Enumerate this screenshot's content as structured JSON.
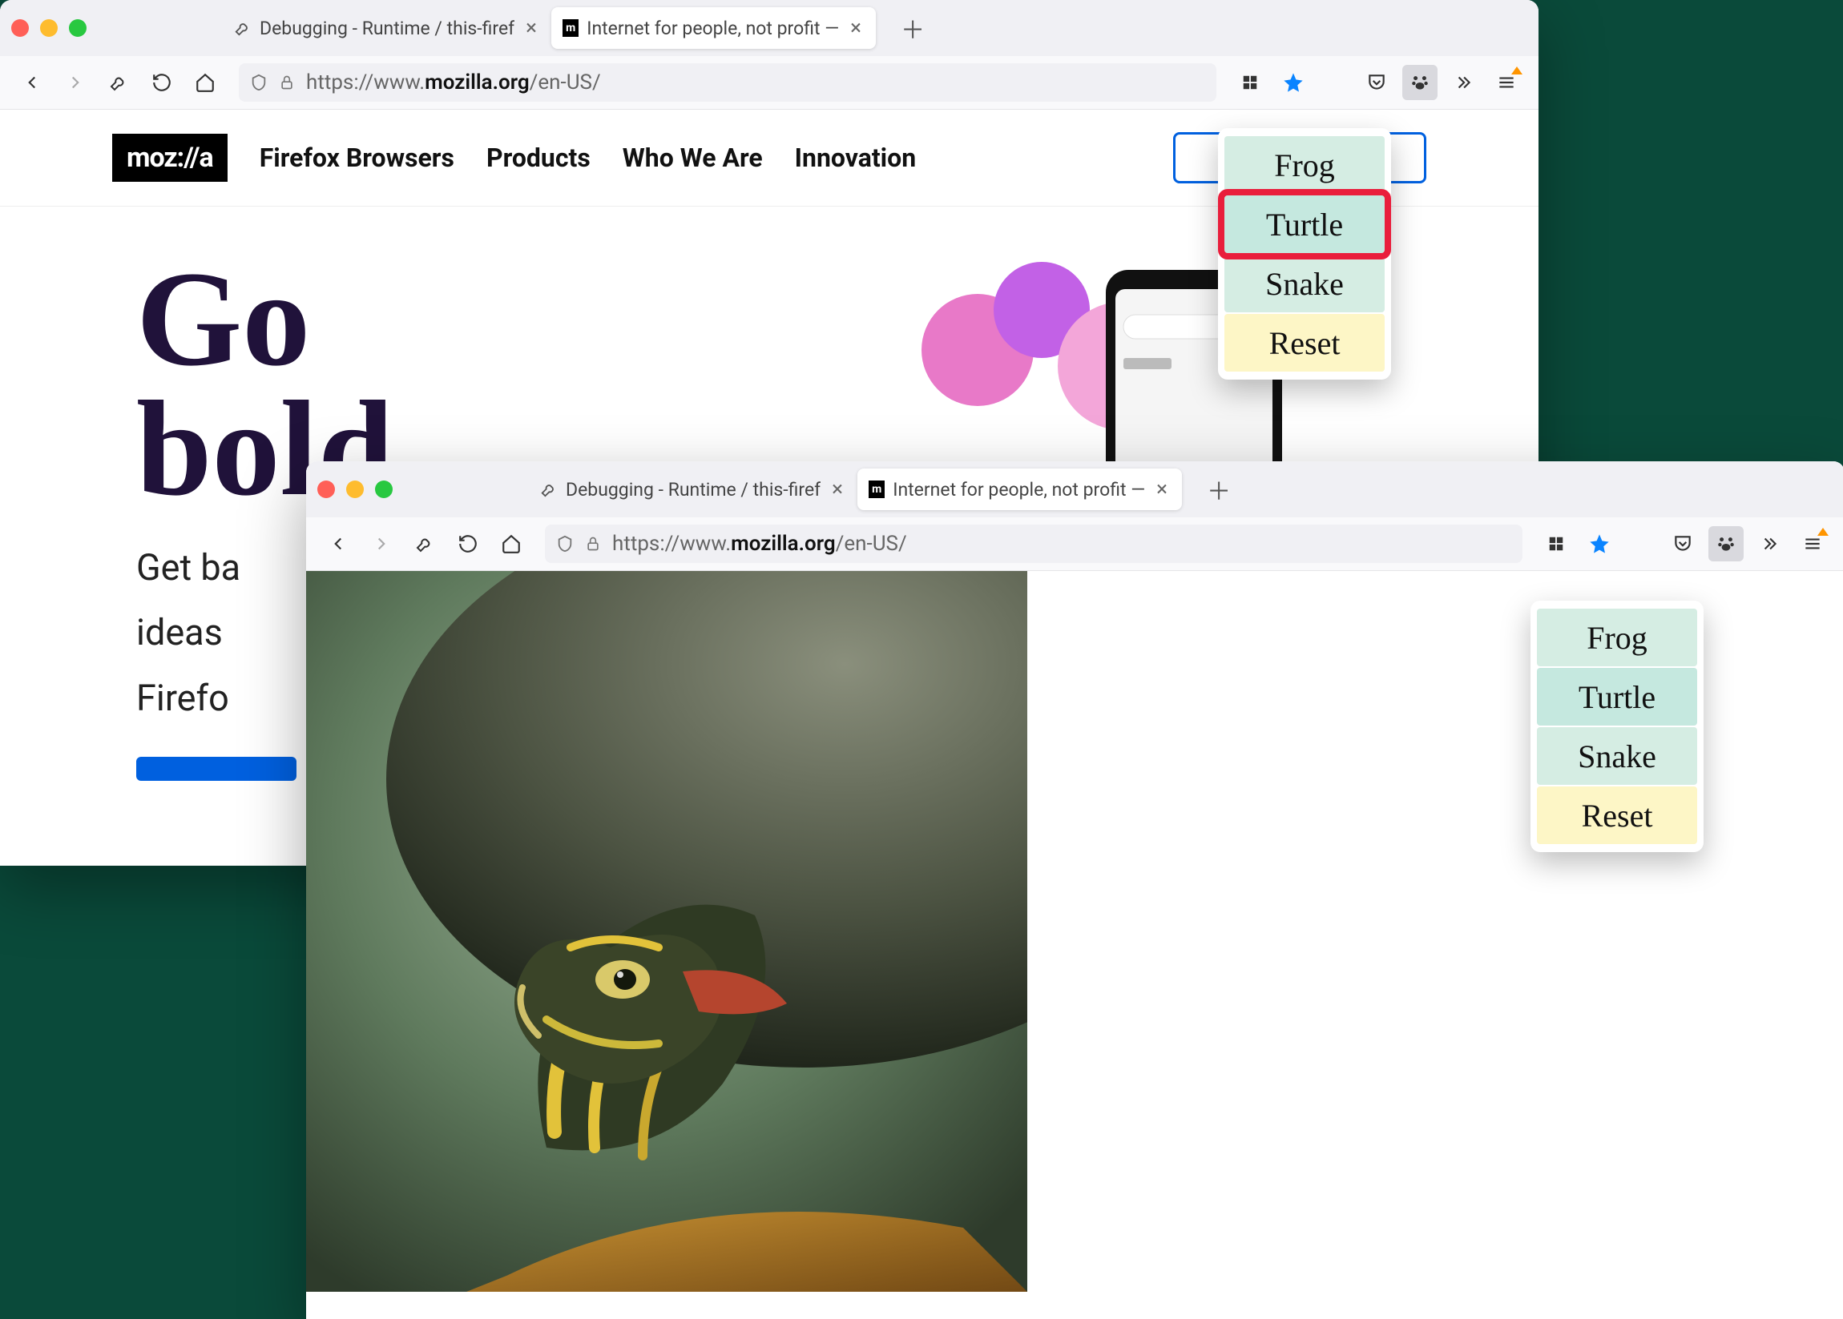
{
  "windows": [
    {
      "tabs": [
        {
          "label": "Debugging - Runtime / this-firef",
          "active": false
        },
        {
          "label": "Internet for people, not profit —",
          "active": true
        }
      ],
      "url_prefix": "https://www.",
      "url_domain": "mozilla.org",
      "url_path": "/en-US/",
      "nav": {
        "logo": "moz://a",
        "links": [
          "Firefox Browsers",
          "Products",
          "Who We Are",
          "Innovation"
        ]
      },
      "hero": {
        "h1a": "Go",
        "h1b": "bold",
        "p1": "Get ba",
        "p2": "ideas",
        "p3": "Firefo"
      }
    },
    {
      "tabs": [
        {
          "label": "Debugging - Runtime / this-firef",
          "active": false
        },
        {
          "label": "Internet for people, not profit —",
          "active": true
        }
      ],
      "url_prefix": "https://www.",
      "url_domain": "mozilla.org",
      "url_path": "/en-US/"
    }
  ],
  "popup": {
    "items": [
      "Frog",
      "Turtle",
      "Snake",
      "Reset"
    ]
  }
}
